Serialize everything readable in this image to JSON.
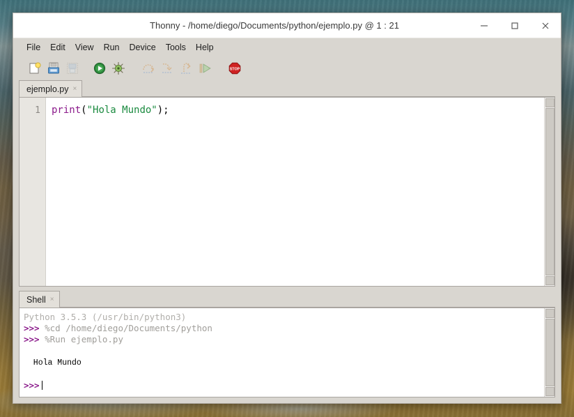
{
  "window": {
    "title": "Thonny - /home/diego/Documents/python/ejemplo.py @ 1 : 21",
    "controls": {
      "minimize_label": "–",
      "maximize_label": "□",
      "close_label": "✕",
      "minimize_name": "minimize",
      "maximize_name": "maximize",
      "close_name": "close"
    },
    "frame_color": "#d9d6d0",
    "titlebar_color": "#ffffff"
  },
  "menubar": {
    "items": [
      {
        "label": "File"
      },
      {
        "label": "Edit"
      },
      {
        "label": "View"
      },
      {
        "label": "Run"
      },
      {
        "label": "Device"
      },
      {
        "label": "Tools"
      },
      {
        "label": "Help"
      }
    ]
  },
  "toolbar": {
    "buttons": [
      {
        "icon": "new-file-icon",
        "tooltip": "New",
        "enabled": true
      },
      {
        "icon": "open-file-icon",
        "tooltip": "Load",
        "enabled": true
      },
      {
        "icon": "save-file-icon",
        "tooltip": "Save",
        "enabled": false
      },
      {
        "icon": "run-play-icon",
        "tooltip": "Run current script",
        "enabled": true
      },
      {
        "icon": "debug-bug-icon",
        "tooltip": "Debug current script",
        "enabled": true
      },
      {
        "icon": "step-over-icon",
        "tooltip": "Step over",
        "enabled": false
      },
      {
        "icon": "step-into-icon",
        "tooltip": "Step into",
        "enabled": false
      },
      {
        "icon": "step-out-icon",
        "tooltip": "Step out",
        "enabled": false
      },
      {
        "icon": "resume-icon",
        "tooltip": "Resume",
        "enabled": false
      },
      {
        "icon": "stop-sign-icon",
        "tooltip": "Stop/Restart backend",
        "enabled": true
      }
    ],
    "stop_label": "STOP"
  },
  "editor": {
    "tab": {
      "label": "ejemplo.py",
      "close_glyph": "×"
    },
    "line_numbers": [
      "1"
    ],
    "code_tokens": [
      {
        "text": "print",
        "type": "kw"
      },
      {
        "text": "(",
        "type": "plain"
      },
      {
        "text": "\"Hola Mundo\"",
        "type": "str"
      },
      {
        "text": ");",
        "type": "plain"
      }
    ],
    "code_plain": "print(\"Hola Mundo\");",
    "colors": {
      "keyword": "#8b1a8b",
      "string": "#1a8a3f",
      "plain": "#000000",
      "gutter_text": "#8d8a86"
    }
  },
  "shell": {
    "tab": {
      "label": "Shell",
      "close_glyph": "×"
    },
    "lines": [
      {
        "kind": "system",
        "text": "Python 3.5.3 (/usr/bin/python3)"
      },
      {
        "kind": "command",
        "prompt": ">>>",
        "text": " %cd /home/diego/Documents/python"
      },
      {
        "kind": "command",
        "prompt": ">>>",
        "text": " %Run ejemplo.py"
      },
      {
        "kind": "blank",
        "text": ""
      },
      {
        "kind": "output",
        "text": "  Hola Mundo"
      },
      {
        "kind": "blank",
        "text": ""
      },
      {
        "kind": "input",
        "prompt": ">>>",
        "text": ""
      }
    ],
    "colors": {
      "prompt": "#8b1a8b",
      "system": "#b0aeaa",
      "command": "#a09e9a",
      "output": "#000000"
    }
  },
  "scrollbars": {
    "editor": {
      "up_glyph": "▲",
      "down_glyph": "▼"
    },
    "shell": {
      "up_glyph": "▲",
      "down_glyph": "▼"
    }
  }
}
